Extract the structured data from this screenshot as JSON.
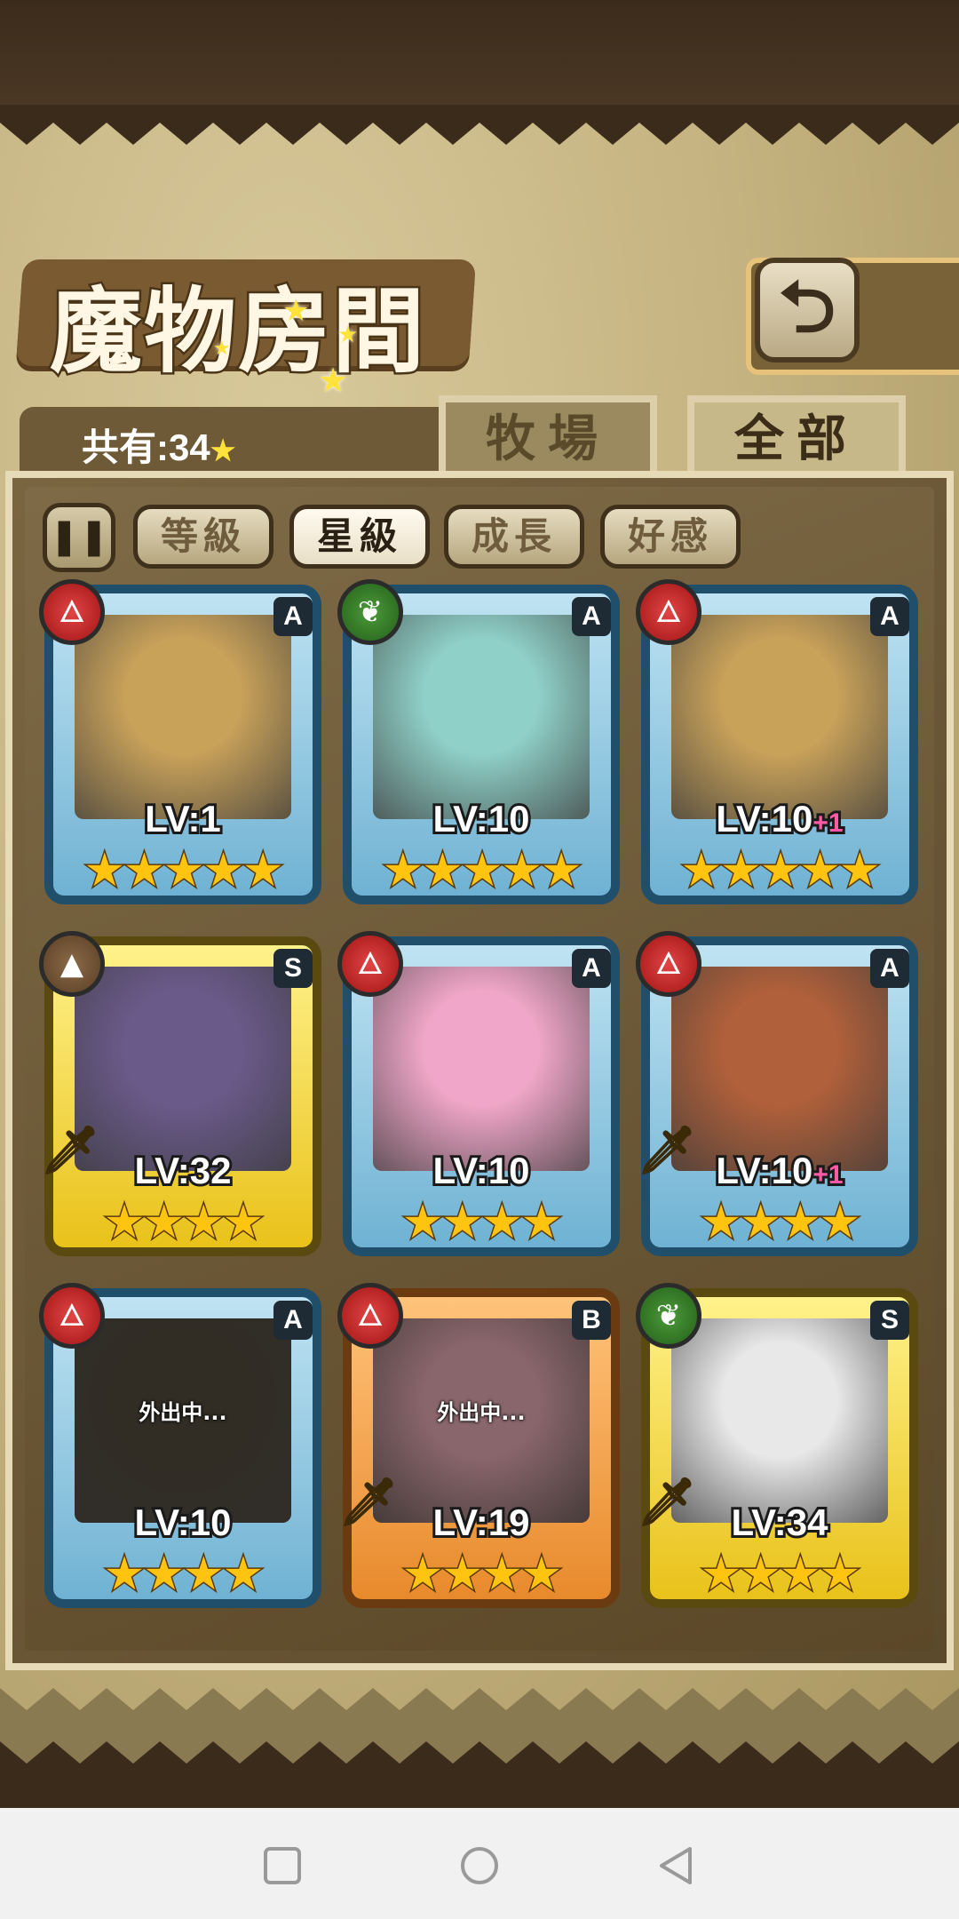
{
  "header": {
    "title": "魔物房間",
    "back_icon": "return-arrow-icon"
  },
  "tabs": {
    "count_label": "共有:34",
    "ranch": "牧場",
    "all": "全部",
    "active": "全部"
  },
  "filters": {
    "toggle_icon": "pause-sort-icon",
    "level": "等級",
    "star": "星級",
    "growth": "成長",
    "affection": "好感",
    "active": "星級"
  },
  "cards": [
    {
      "element": "fire",
      "rank": "A",
      "level": "LV:1",
      "bonus": "",
      "stars": 5,
      "frame": "blue",
      "status": "",
      "weapon": false
    },
    {
      "element": "leaf",
      "rank": "A",
      "level": "LV:10",
      "bonus": "",
      "stars": 5,
      "frame": "blue",
      "status": "",
      "weapon": false
    },
    {
      "element": "fire",
      "rank": "A",
      "level": "LV:10",
      "bonus": "+1",
      "stars": 5,
      "frame": "blue",
      "status": "",
      "weapon": false
    },
    {
      "element": "earth",
      "rank": "S",
      "level": "LV:32",
      "bonus": "",
      "stars": 4,
      "frame": "gold",
      "status": "",
      "weapon": true
    },
    {
      "element": "fire",
      "rank": "A",
      "level": "LV:10",
      "bonus": "",
      "stars": 4,
      "frame": "blue",
      "status": "",
      "weapon": false
    },
    {
      "element": "fire",
      "rank": "A",
      "level": "LV:10",
      "bonus": "+1",
      "stars": 4,
      "frame": "blue",
      "status": "",
      "weapon": true
    },
    {
      "element": "fire",
      "rank": "A",
      "level": "LV:10",
      "bonus": "",
      "stars": 4,
      "frame": "blue",
      "status": "外出中...",
      "weapon": false
    },
    {
      "element": "fire",
      "rank": "B",
      "level": "LV:19",
      "bonus": "",
      "stars": 4,
      "frame": "orange",
      "status": "外出中...",
      "weapon": true
    },
    {
      "element": "leaf",
      "rank": "S",
      "level": "LV:34",
      "bonus": "",
      "stars": 4,
      "frame": "gold",
      "status": "",
      "weapon": true
    }
  ],
  "colors": {
    "art": [
      "#c9a25a",
      "#8fd0c8",
      "#c9a25a",
      "#6a5a8a",
      "#f0a6c8",
      "#b0603a",
      "#3a3a30",
      "#d8a0b0",
      "#e8e8e8"
    ]
  },
  "navbar": {
    "recents_icon": "square-icon",
    "home_icon": "circle-icon",
    "back_icon": "triangle-back-icon"
  }
}
